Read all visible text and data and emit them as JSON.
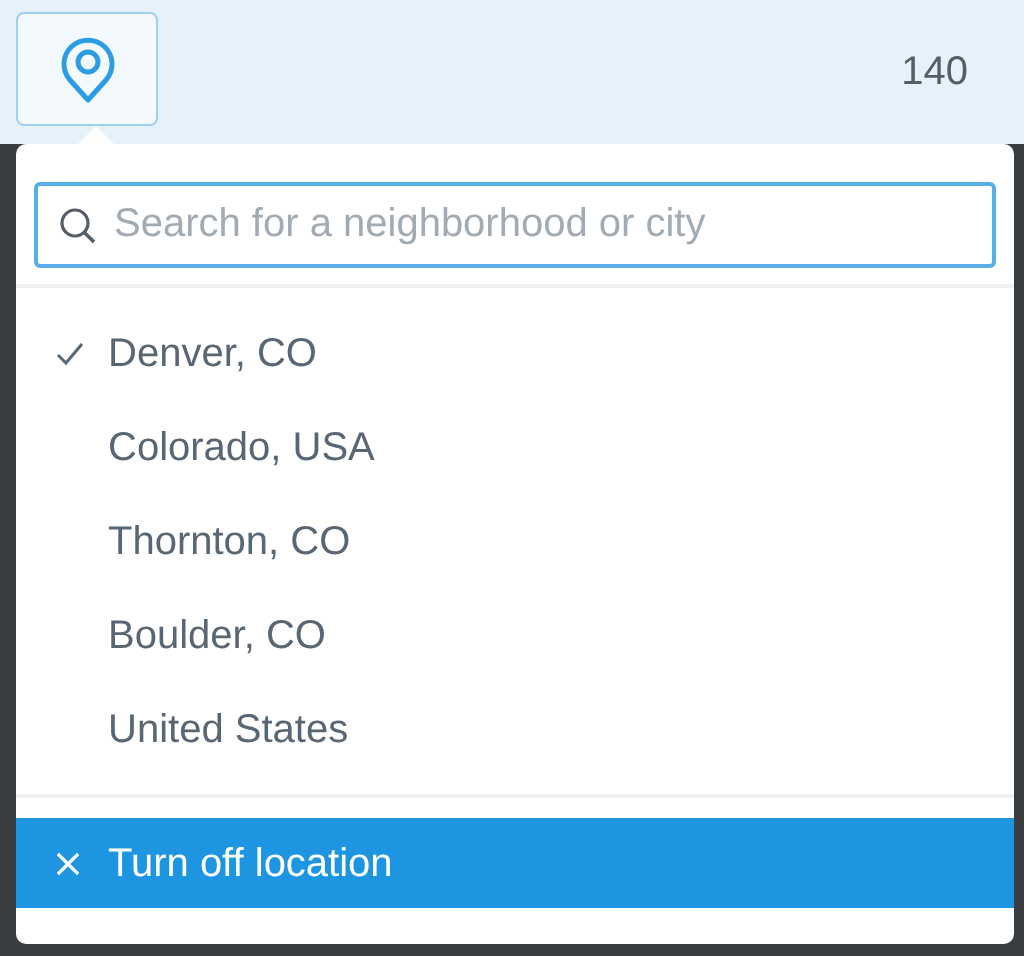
{
  "header": {
    "count": "140"
  },
  "location_menu": {
    "search": {
      "placeholder": "Search for a neighborhood or city"
    },
    "options": [
      {
        "label": "Denver, CO",
        "selected": true
      },
      {
        "label": "Colorado, USA",
        "selected": false
      },
      {
        "label": "Thornton, CO",
        "selected": false
      },
      {
        "label": "Boulder, CO",
        "selected": false
      },
      {
        "label": "United States",
        "selected": false
      }
    ],
    "action": {
      "label": "Turn off location",
      "highlighted": true
    }
  }
}
